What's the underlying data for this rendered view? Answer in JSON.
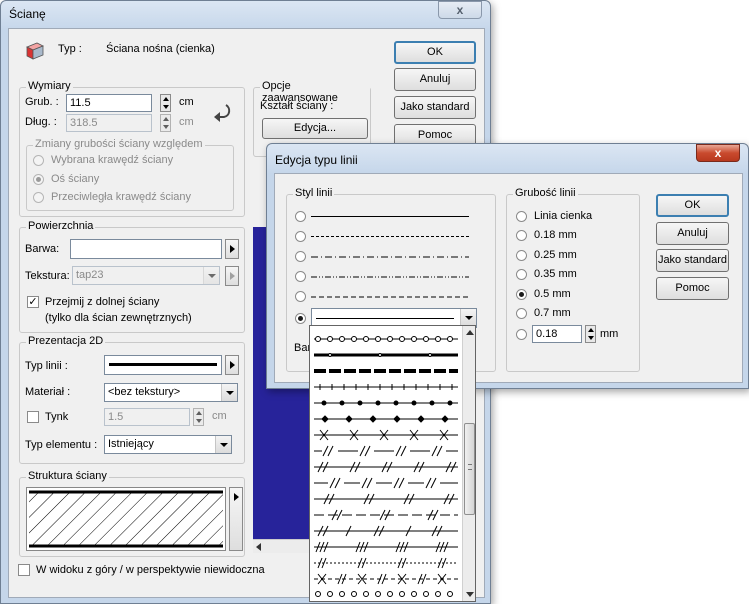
{
  "walls_dialog": {
    "title": "Ścianę",
    "close": "x",
    "type_label": "Typ :",
    "type_value": "Ściana nośna (cienka)",
    "buttons": {
      "ok": "OK",
      "cancel": "Anuluj",
      "as_default": "Jako standard",
      "help": "Pomoc"
    },
    "dimensions": {
      "group": "Wymiary",
      "thickness_label": "Grub. :",
      "thickness_value": "11.5",
      "thickness_unit": "cm",
      "length_label": "Dług. :",
      "length_value": "318.5",
      "length_unit": "cm"
    },
    "thickness_change": {
      "group": "Zmiany grubości ściany względem",
      "options": [
        "Wybrana krawędź ściany",
        "Oś ściany",
        "Przeciwległa krawędź ściany"
      ],
      "selected": 1
    },
    "advanced": {
      "group": "Opcje zaawansowane",
      "shape_label": "Kształt ściany :",
      "edit_button": "Edycja..."
    },
    "surface": {
      "group": "Powierzchnia",
      "color_label": "Barwa:",
      "texture_label": "Tekstura:",
      "texture_value": "tap23",
      "inherit_label": "Przejmij z dolnej ściany",
      "inherit_note": "(tylko dla ścian zewnętrznych)",
      "inherit_checked": true
    },
    "presentation": {
      "group": "Prezentacja 2D",
      "line_type_label": "Typ linii :",
      "material_label": "Materiał :",
      "material_value": "<bez tekstury>",
      "plaster_label": "Tynk",
      "plaster_value": "1.5",
      "plaster_unit": "cm",
      "element_type_label": "Typ elementu :",
      "element_type_value": "Istniejący"
    },
    "structure": {
      "group": "Struktura ściany"
    },
    "invisible_label": "W widoku z góry / w perspektywie niewidoczna"
  },
  "line_type_dialog": {
    "title": "Edycja typu linii",
    "close": "x",
    "style_group": "Styl linii",
    "style_selected": 5,
    "partial_label": "Bar",
    "thickness_group": "Grubość linii",
    "thickness_options": [
      "Linia cienka",
      "0.18 mm",
      "0.25 mm",
      "0.35 mm",
      "0.5 mm",
      "0.7 mm"
    ],
    "thickness_selected": 4,
    "custom_value": "0.18",
    "custom_unit": "mm",
    "buttons": {
      "ok": "OK",
      "cancel": "Anuluj",
      "as_default": "Jako standard",
      "help": "Pomoc"
    }
  },
  "colors": {
    "accent_blue": "#27239a",
    "close_red": "#c94a2e",
    "title_gradient": "#c5d6ea"
  },
  "icons": {
    "wall_type": "wall-3d-icon",
    "undo": "undo-arrow-icon"
  }
}
